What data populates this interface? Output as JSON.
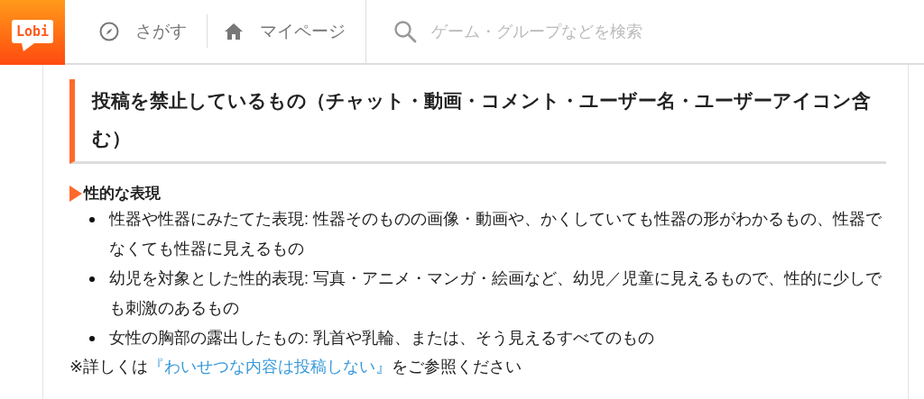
{
  "header": {
    "logo": "Lobi",
    "nav": [
      {
        "label": "さがす"
      },
      {
        "label": "マイページ"
      }
    ],
    "search": {
      "placeholder": "ゲーム・グループなどを検索"
    }
  },
  "article": {
    "heading": "投稿を禁止しているもの（チャット・動画・コメント・ユーザー名・ユーザーアイコン含む）",
    "sections": [
      {
        "title": "性的な表現",
        "items": [
          "性器や性器にみたてた表現: 性器そのものの画像・動画や、かくしていても性器の形がわかるもの、性器でなくても性器に見えるもの",
          "幼児を対象とした性的表現: 写真・アニメ・マンガ・絵画など、幼児／児童に見えるもので、性的に少しでも刺激のあるもの",
          "女性の胸部の露出したもの: 乳首や乳輪、または、そう見えるすべてのもの"
        ],
        "note": {
          "before": "※詳しくは",
          "link": "『わいせつな内容は投稿しない』",
          "after": "をご参照ください"
        }
      }
    ]
  }
}
